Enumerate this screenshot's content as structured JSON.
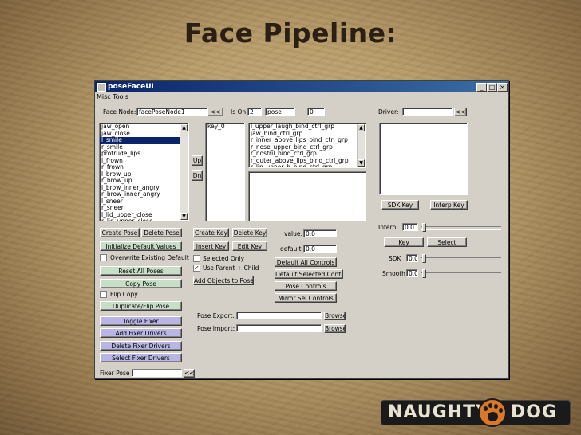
{
  "slide_title": "Face Pipeline:",
  "window": {
    "title": "poseFaceUI",
    "menu": "Misc Tools",
    "min": "_",
    "max": "□",
    "close": "×"
  },
  "top": {
    "face_node_label": "Face Node:",
    "face_node_value": "facePoseNode1",
    "load_btn": "<<",
    "is_on_label": "Is On",
    "is_on_value": "2",
    "pose_value": "pose",
    "count_value": "0",
    "driver_label": "Driver:",
    "driver_value": "",
    "driver_btn": "<<"
  },
  "pose_list": [
    "jaw_open",
    "jaw_close",
    "l_smile",
    "r_smile",
    "protrude_lips",
    "l_frown",
    "r_frown",
    "l_brow_up",
    "r_brow_up",
    "l_brow_inner_angry",
    "r_brow_inner_angry",
    "l_sneer",
    "r_sneer",
    "l_lid_upper_close",
    "r_lid_upper_close"
  ],
  "pose_selected_index": 2,
  "key_list": [
    "key_0"
  ],
  "up_btn": "Up",
  "dn_btn": "Dn",
  "control_list": [
    "l_upper_laugh_bind_ctrl_grp",
    "jaw_bind_ctrl_grp",
    "r_inner_above_lips_bind_ctrl_grp",
    "r_nose_upper_bind_ctrl_grp",
    "r_nostril_bind_ctrl_grp",
    "r_outer_above_lips_bind_ctrl_grp",
    "r_lip_upper_b_bind_ctrl_grp"
  ],
  "left_buttons": {
    "create_pose": "Create Pose",
    "delete_pose": "Delete Pose",
    "init_default": "Initialize Default Values",
    "overwrite_default": "Overwrite Existing Default",
    "reset_all": "Reset All Poses",
    "copy_pose": "Copy Pose",
    "flip_copy": "Flip Copy",
    "dup_flip": "Duplicate/Flip Pose",
    "toggle_fixer": "Toggle Fixer",
    "add_fixer": "Add Fixer Drivers",
    "delete_fixer": "Delete Fixer Drivers",
    "select_fixer": "Select Fixer Drivers",
    "fixer_pose_label": "Fixer Pose",
    "fixer_btn": "<<"
  },
  "mid": {
    "create_key": "Create Key",
    "delete_key": "Delete Key",
    "insert_key": "Insert Key",
    "edit_key": "Edit Key",
    "value_label": "value:",
    "value": "0.0",
    "default_label": "default:",
    "default": "0.0",
    "selected_only": "Selected Only",
    "use_parent_child": "Use Parent + Child",
    "add_objects": "Add Objects to Pose",
    "default_all": "Default All Controls",
    "default_selected": "Default Selected Controls",
    "pose_controls": "Pose Controls",
    "mirror_sel": "Mirror Sel Controls",
    "pose_export_label": "Pose Export:",
    "pose_import_label": "Pose Import:",
    "browse": "Browse"
  },
  "right": {
    "sdk_key": "SDK Key",
    "interp_key": "Interp Key",
    "interp_label": "Interp",
    "interp_value": "0.0",
    "key": "Key",
    "select": "Select",
    "sdk_label": "SDK",
    "sdk_value": "0.0",
    "smooth_label": "Smooth",
    "smooth_value": "0.0"
  },
  "logo": {
    "left": "NAUGHTY",
    "right": "DOG"
  },
  "colors": {
    "title_bar": "#0a246a",
    "purple_button": "#b9b6e6",
    "green_button": "#c7dec7",
    "paw": "#d9782a"
  }
}
